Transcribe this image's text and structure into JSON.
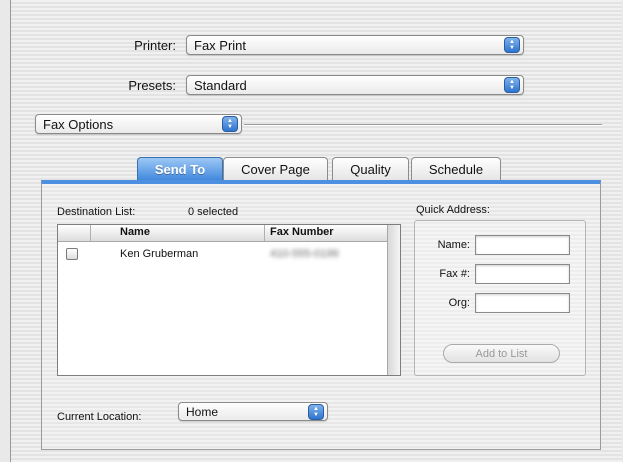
{
  "printer": {
    "label": "Printer:",
    "value": "Fax Print"
  },
  "presets": {
    "label": "Presets:",
    "value": "Standard"
  },
  "pane_menu": {
    "value": "Fax Options"
  },
  "tabs": [
    {
      "label": "Send To",
      "active": true
    },
    {
      "label": "Cover Page",
      "active": false
    },
    {
      "label": "Quality",
      "active": false
    },
    {
      "label": "Schedule",
      "active": false
    }
  ],
  "destination": {
    "label": "Destination List:",
    "selected_count": "0 selected",
    "columns": [
      "Name",
      "Fax Number"
    ],
    "rows": [
      {
        "checked": false,
        "name": "Ken Gruberman",
        "fax": "410-555-0199"
      }
    ]
  },
  "quick_address": {
    "title": "Quick Address:",
    "name_label": "Name:",
    "fax_label": "Fax #:",
    "org_label": "Org:",
    "name_value": "",
    "fax_value": "",
    "org_value": "",
    "add_button": "Add to List"
  },
  "location": {
    "label": "Current Location:",
    "value": "Home"
  },
  "colors": {
    "accent": "#3f86dc"
  }
}
